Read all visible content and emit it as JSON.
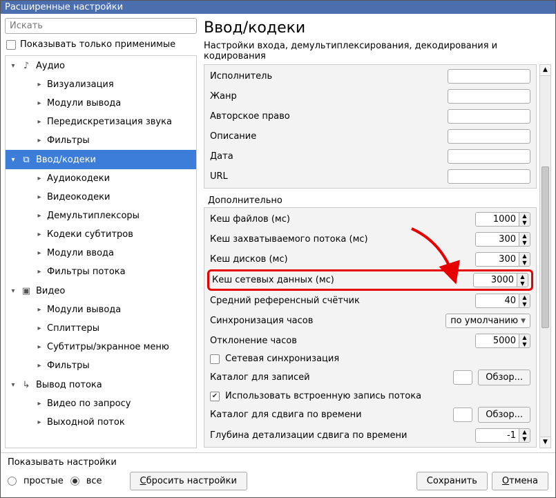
{
  "window_title": "Расширенные настройки",
  "search_placeholder": "Искать",
  "show_applicable_label": "Показывать только применимые",
  "tree": [
    {
      "level": 0,
      "expand": "down",
      "icon": "audio",
      "label": "Аудио"
    },
    {
      "level": 1,
      "expand": "right",
      "label": "Визуализация"
    },
    {
      "level": 1,
      "expand": "right",
      "label": "Модули вывода"
    },
    {
      "level": 1,
      "expand": "right",
      "label": "Передискретизация звука"
    },
    {
      "level": 1,
      "expand": "right",
      "label": "Фильтры"
    },
    {
      "level": 0,
      "expand": "down",
      "icon": "input",
      "label": "Ввод/кодеки",
      "selected": true
    },
    {
      "level": 1,
      "expand": "right",
      "label": "Аудиокодеки"
    },
    {
      "level": 1,
      "expand": "right",
      "label": "Видеокодеки"
    },
    {
      "level": 1,
      "expand": "right",
      "label": "Демультиплексоры"
    },
    {
      "level": 1,
      "expand": "right",
      "label": "Кодеки субтитров"
    },
    {
      "level": 1,
      "expand": "right",
      "label": "Модули ввода"
    },
    {
      "level": 1,
      "expand": "right",
      "label": "Фильтры потока"
    },
    {
      "level": 0,
      "expand": "down",
      "icon": "video",
      "label": "Видео"
    },
    {
      "level": 1,
      "expand": "right",
      "label": "Модули вывода"
    },
    {
      "level": 1,
      "expand": "right",
      "label": "Сплиттеры"
    },
    {
      "level": 1,
      "expand": "right",
      "label": "Субтитры/экранное меню"
    },
    {
      "level": 1,
      "expand": "right",
      "label": "Фильтры"
    },
    {
      "level": 0,
      "expand": "down",
      "icon": "sout",
      "label": "Вывод потока"
    },
    {
      "level": 1,
      "expand": "right",
      "label": "Видео по запросу"
    },
    {
      "level": 1,
      "expand": "right",
      "label": "Выходной поток"
    }
  ],
  "page_title": "Ввод/кодеки",
  "page_subtitle": "Настройки входа, демультиплексирования, декодирования и кодирования",
  "top_group_rows": [
    {
      "label": "Исполнитель",
      "value": ""
    },
    {
      "label": "Жанр",
      "value": ""
    },
    {
      "label": "Авторское право",
      "value": ""
    },
    {
      "label": "Описание",
      "value": ""
    },
    {
      "label": "Дата",
      "value": ""
    },
    {
      "label": "URL",
      "value": ""
    }
  ],
  "additional_title": "Дополнительно",
  "additional": {
    "file_cache_label": "Кеш файлов (мс)",
    "file_cache_value": "1000",
    "capture_cache_label": "Кеш захватываемого потока (мс)",
    "capture_cache_value": "300",
    "disc_cache_label": "Кеш дисков (мс)",
    "disc_cache_value": "300",
    "network_cache_label": "Кеш сетевых данных (мс)",
    "network_cache_value": "3000",
    "ref_counter_label": "Средний референсный счётчик",
    "ref_counter_value": "40",
    "clock_sync_label": "Синхронизация часов",
    "clock_sync_value": "по умолчанию",
    "clock_dev_label": "Отклонение часов",
    "clock_dev_value": "5000",
    "net_sync_label": "Сетевая синхронизация",
    "net_sync_checked": false,
    "record_dir_label": "Каталог для записей",
    "record_dir_value": "",
    "use_builtin_label": "Использовать встроенную запись потока",
    "use_builtin_checked": true,
    "timeshift_dir_label": "Каталог для сдвига по времени",
    "timeshift_dir_value": "",
    "timeshift_depth_label": "Глубина детализации сдвига по времени",
    "timeshift_depth_value": "-1",
    "browse_label": "Обзор..."
  },
  "bottom": {
    "show_settings_label": "Показывать настройки",
    "simple_label": "простые",
    "all_label": "все",
    "reset_label": "Сбросить настройки",
    "save_label": "Сохранить",
    "cancel_label": "Отмена"
  }
}
